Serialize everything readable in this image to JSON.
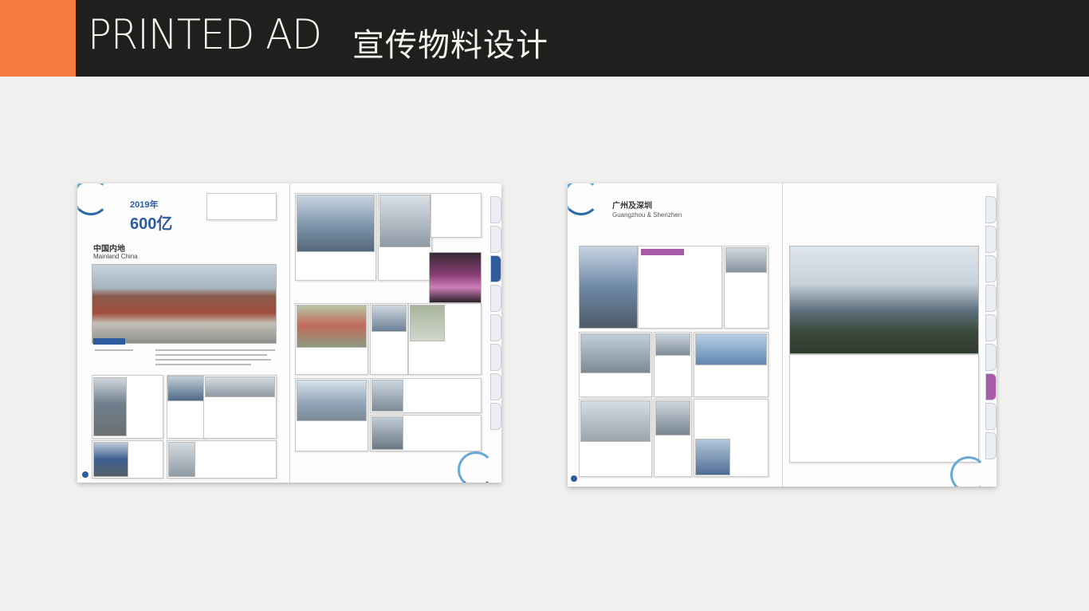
{
  "header": {
    "title_en": "PRINTED AD",
    "title_cn": "宣传物料设计",
    "accent_color": "#f47b3e",
    "bar_color": "#1f1f1d"
  },
  "spread_left": {
    "hero_year": "2019年",
    "hero_amount": "600亿",
    "region_cn": "中国内地",
    "region_en": "Mainland China"
  },
  "spread_right": {
    "region_cn": "广州及深圳",
    "region_en": "Guangzhou & Shenzhen"
  }
}
